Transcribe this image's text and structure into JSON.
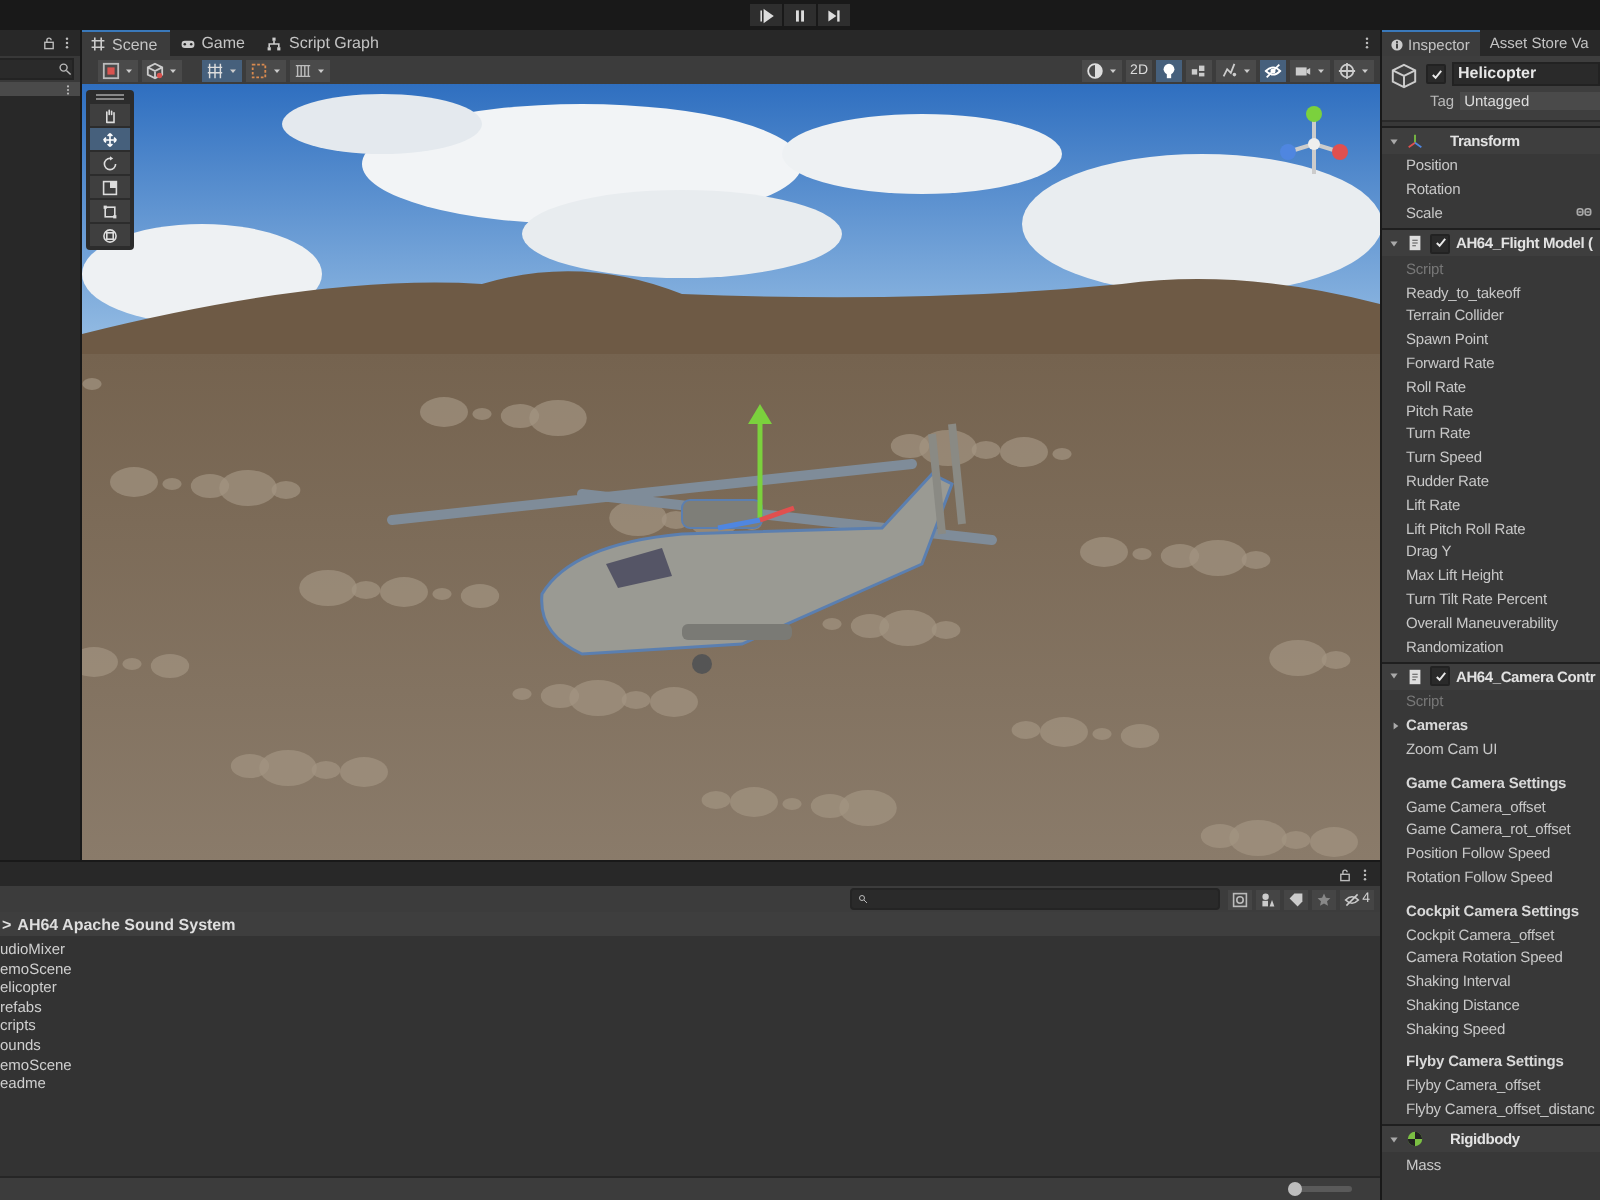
{
  "scene_tabs": [
    {
      "kind": "scene",
      "label": "Scene",
      "selected": true
    },
    {
      "kind": "game",
      "label": "Game",
      "selected": false
    },
    {
      "kind": "graph",
      "label": "Script Graph",
      "selected": false
    }
  ],
  "scene_toolbar_left": [
    {
      "kind": "gizmo-tool",
      "on": false,
      "has_dropdown": true
    },
    {
      "kind": "view-options",
      "on": false,
      "has_dropdown": true
    },
    {
      "kind": "grid-snap",
      "on": true,
      "has_dropdown": true
    },
    {
      "kind": "snap-increment",
      "on": false,
      "has_dropdown": true
    },
    {
      "kind": "grid-plane",
      "on": false,
      "has_dropdown": true
    }
  ],
  "scene_toolbar_right": [
    {
      "kind": "shading",
      "on": false,
      "has_dropdown": true
    },
    {
      "kind": "text",
      "label": "2D",
      "on": false,
      "has_dropdown": false
    },
    {
      "kind": "lighting",
      "on": true,
      "has_dropdown": false
    },
    {
      "kind": "audio",
      "on": false,
      "has_dropdown": false
    },
    {
      "kind": "effects",
      "on": false,
      "has_dropdown": true
    },
    {
      "kind": "visibility",
      "on": true,
      "has_dropdown": false
    },
    {
      "kind": "camera",
      "on": false,
      "has_dropdown": true
    },
    {
      "kind": "gizmos",
      "on": false,
      "has_dropdown": true
    }
  ],
  "scene_tools": [
    {
      "kind": "hand",
      "selected": false
    },
    {
      "kind": "move",
      "selected": true
    },
    {
      "kind": "rotate",
      "selected": false
    },
    {
      "kind": "scale",
      "selected": false
    },
    {
      "kind": "rect",
      "selected": false
    },
    {
      "kind": "transform",
      "selected": false
    }
  ],
  "project": {
    "breadcrumb_arrow": ">",
    "breadcrumb": "AH64 Apache Sound System",
    "hidden_count": "4",
    "items": [
      {
        "label": "udioMixer"
      },
      {
        "label": "emoScene"
      },
      {
        "label": "elicopter"
      },
      {
        "label": "refabs"
      },
      {
        "label": "cripts"
      },
      {
        "label": "ounds"
      },
      {
        "label": "emoScene"
      },
      {
        "label": "eadme"
      }
    ],
    "zoom_slider": {
      "level": 0.08
    }
  },
  "inspector": {
    "tabs": [
      {
        "label": "Inspector",
        "selected": true
      },
      {
        "label": "Asset Store Va",
        "selected": false
      }
    ],
    "object": {
      "active": true,
      "name": "Helicopter",
      "tag_label": "Tag",
      "tag": "Untagged"
    },
    "components": [
      {
        "kind": "transform",
        "title": "Transform",
        "expanded": true,
        "fields": [
          {
            "kind": "field",
            "label": "Position"
          },
          {
            "kind": "field",
            "label": "Rotation"
          },
          {
            "kind": "linked",
            "label": "Scale"
          }
        ]
      },
      {
        "kind": "script",
        "title": "AH64_Flight Model (",
        "enabled": true,
        "expanded": true,
        "fields": [
          {
            "kind": "script",
            "label": "Script"
          },
          {
            "kind": "field",
            "label": "Ready_to_takeoff"
          },
          {
            "kind": "field",
            "label": "Terrain Collider"
          },
          {
            "kind": "field",
            "label": "Spawn Point"
          },
          {
            "kind": "field",
            "label": "Forward Rate"
          },
          {
            "kind": "field",
            "label": "Roll Rate"
          },
          {
            "kind": "field",
            "label": "Pitch Rate"
          },
          {
            "kind": "field",
            "label": "Turn Rate"
          },
          {
            "kind": "field",
            "label": "Turn Speed"
          },
          {
            "kind": "field",
            "label": "Rudder Rate"
          },
          {
            "kind": "field",
            "label": "Lift Rate"
          },
          {
            "kind": "field",
            "label": "Lift Pitch Roll Rate"
          },
          {
            "kind": "field",
            "label": "Drag Y"
          },
          {
            "kind": "field",
            "label": "Max Lift Height"
          },
          {
            "kind": "field",
            "label": "Turn Tilt Rate Percent"
          },
          {
            "kind": "field",
            "label": "Overall Maneuverability"
          },
          {
            "kind": "field",
            "label": "Randomization"
          }
        ]
      },
      {
        "kind": "script",
        "title": "AH64_Camera Contr",
        "enabled": true,
        "expanded": true,
        "fields": [
          {
            "kind": "script",
            "label": "Script"
          },
          {
            "kind": "foldout",
            "label": "Cameras",
            "expanded": false
          },
          {
            "kind": "field",
            "label": "Zoom Cam UI"
          },
          {
            "kind": "header",
            "label": "Game Camera Settings"
          },
          {
            "kind": "field",
            "label": "Game Camera_offset"
          },
          {
            "kind": "field",
            "label": "Game Camera_rot_offset"
          },
          {
            "kind": "field",
            "label": "Position Follow Speed"
          },
          {
            "kind": "field",
            "label": "Rotation Follow Speed"
          },
          {
            "kind": "header",
            "label": "Cockpit Camera Settings"
          },
          {
            "kind": "field",
            "label": "Cockpit Camera_offset"
          },
          {
            "kind": "field",
            "label": "Camera Rotation Speed"
          },
          {
            "kind": "field",
            "label": "Shaking Interval"
          },
          {
            "kind": "field",
            "label": "Shaking Distance"
          },
          {
            "kind": "field",
            "label": "Shaking Speed"
          },
          {
            "kind": "header",
            "label": "Flyby Camera Settings"
          },
          {
            "kind": "field",
            "label": "Flyby Camera_offset"
          },
          {
            "kind": "field",
            "label": "Flyby Camera_offset_distanc"
          }
        ]
      },
      {
        "kind": "rigidbody",
        "title": "Rigidbody",
        "expanded": true,
        "fields": [
          {
            "kind": "field",
            "label": "Mass"
          }
        ]
      }
    ]
  }
}
